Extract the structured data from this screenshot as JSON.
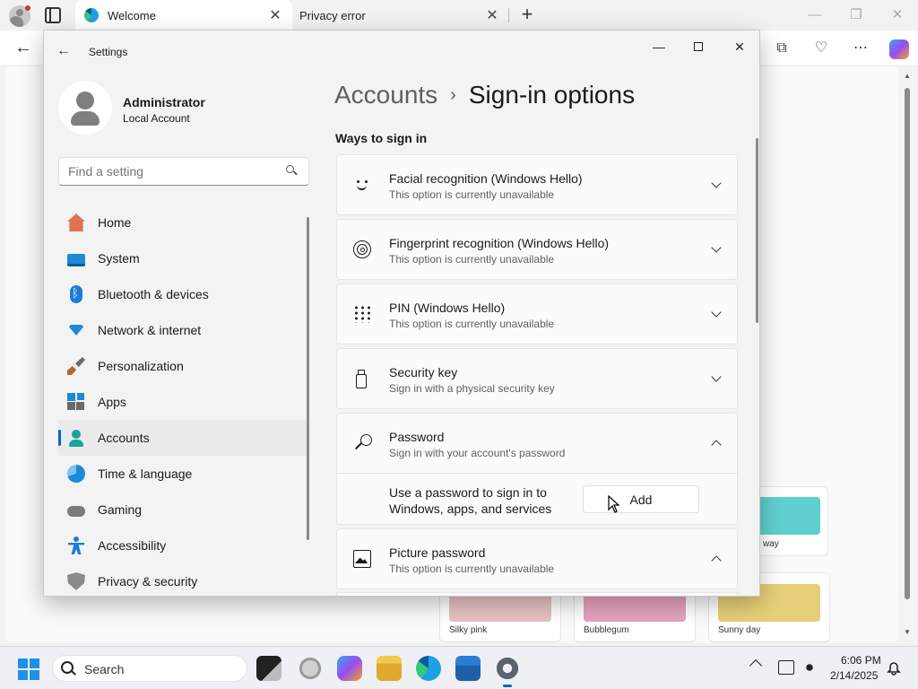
{
  "browser": {
    "tabs": [
      {
        "label": "Welcome",
        "active": true
      },
      {
        "label": "Privacy error",
        "active": false
      }
    ]
  },
  "themes": [
    {
      "label": "way",
      "color": "#5fcfcf"
    },
    {
      "label": "Silky pink",
      "color": "#e6c2c2"
    },
    {
      "label": "Bubblegum",
      "color": "#e6a3bd"
    },
    {
      "label": "Sunny day",
      "color": "#e6cf78"
    }
  ],
  "settings": {
    "window_title": "Settings",
    "user": {
      "name": "Administrator",
      "account_type": "Local Account"
    },
    "search_placeholder": "Find a setting",
    "nav": [
      {
        "label": "Home",
        "icon": "home-icon"
      },
      {
        "label": "System",
        "icon": "system-icon"
      },
      {
        "label": "Bluetooth & devices",
        "icon": "bluetooth-icon"
      },
      {
        "label": "Network & internet",
        "icon": "wifi-icon"
      },
      {
        "label": "Personalization",
        "icon": "brush-icon"
      },
      {
        "label": "Apps",
        "icon": "apps-icon"
      },
      {
        "label": "Accounts",
        "icon": "accounts-icon",
        "selected": true
      },
      {
        "label": "Time & language",
        "icon": "globe-clock-icon"
      },
      {
        "label": "Gaming",
        "icon": "gamepad-icon"
      },
      {
        "label": "Accessibility",
        "icon": "accessibility-icon"
      },
      {
        "label": "Privacy & security",
        "icon": "shield-icon"
      }
    ],
    "breadcrumb": {
      "parent": "Accounts",
      "separator": "›",
      "current": "Sign-in options"
    },
    "section_title": "Ways to sign in",
    "options": [
      {
        "title": "Facial recognition (Windows Hello)",
        "subtitle": "This option is currently unavailable",
        "icon": "face-icon",
        "expanded": false
      },
      {
        "title": "Fingerprint recognition (Windows Hello)",
        "subtitle": "This option is currently unavailable",
        "icon": "fingerprint-icon",
        "expanded": false
      },
      {
        "title": "PIN (Windows Hello)",
        "subtitle": "This option is currently unavailable",
        "icon": "pin-keypad-icon",
        "expanded": false
      },
      {
        "title": "Security key",
        "subtitle": "Sign in with a physical security key",
        "icon": "usb-key-icon",
        "expanded": false
      },
      {
        "title": "Password",
        "subtitle": "Sign in with your account's password",
        "icon": "key-icon",
        "expanded": true,
        "detail_text": "Use a password to sign in to Windows, apps, and services",
        "action_label": "Add"
      },
      {
        "title": "Picture password",
        "subtitle": "This option is currently unavailable",
        "icon": "picture-icon",
        "expanded": true
      }
    ]
  },
  "taskbar": {
    "search_label": "Search",
    "time": "6:06 PM",
    "date": "2/14/2025"
  }
}
